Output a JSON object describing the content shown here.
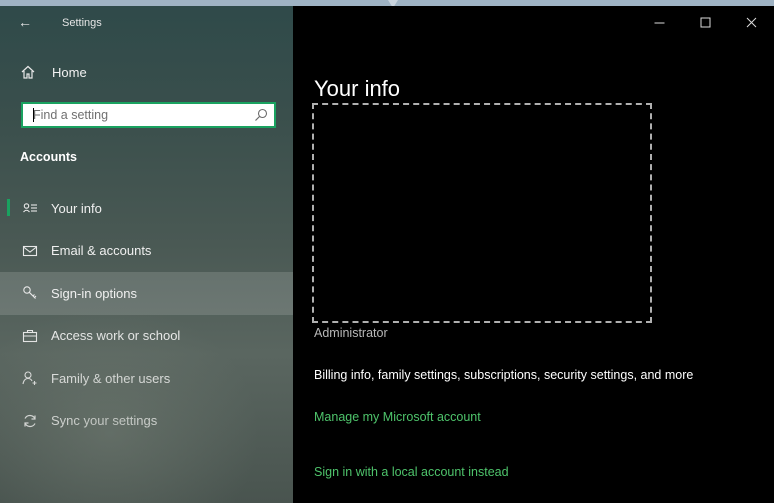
{
  "window": {
    "title": "Settings",
    "back_icon": "back-arrow-icon",
    "controls": {
      "minimize": "minimize-icon",
      "maximize": "maximize-icon",
      "close": "close-icon"
    }
  },
  "sidebar": {
    "home_label": "Home",
    "search": {
      "placeholder": "Find a setting",
      "value": ""
    },
    "section_heading": "Accounts",
    "items": [
      {
        "label": "Your info",
        "icon": "person-card-icon",
        "active": true
      },
      {
        "label": "Email & accounts",
        "icon": "envelope-icon"
      },
      {
        "label": "Sign-in options",
        "icon": "key-icon",
        "hovered": true
      },
      {
        "label": "Access work or school",
        "icon": "briefcase-icon"
      },
      {
        "label": "Family & other users",
        "icon": "person-add-icon"
      },
      {
        "label": "Sync your settings",
        "icon": "sync-icon"
      }
    ]
  },
  "main": {
    "title": "Your info",
    "account_name": "Administrator",
    "billing_text": "Billing info, family settings, subscriptions, security settings, and more",
    "manage_link": "Manage my Microsoft account",
    "local_link": "Sign in with a local account instead"
  },
  "colors": {
    "accent": "#1aa260",
    "link": "#4ec36b",
    "content_bg": "#000000"
  }
}
